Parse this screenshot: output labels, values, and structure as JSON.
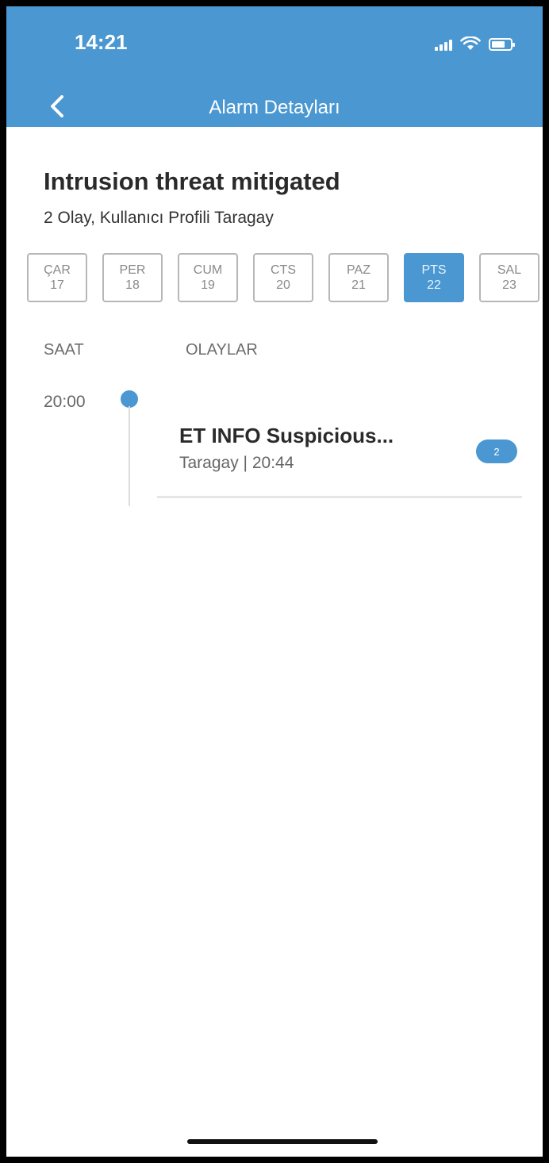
{
  "status_bar": {
    "time": "14:21"
  },
  "header": {
    "title": "Alarm Detayları"
  },
  "alarm": {
    "title": "Intrusion threat mitigated",
    "subtitle": "2 Olay, Kullanıcı Profili Taragay"
  },
  "days": [
    {
      "name": "ÇAR",
      "num": "17",
      "selected": false
    },
    {
      "name": "PER",
      "num": "18",
      "selected": false
    },
    {
      "name": "CUM",
      "num": "19",
      "selected": false
    },
    {
      "name": "CTS",
      "num": "20",
      "selected": false
    },
    {
      "name": "PAZ",
      "num": "21",
      "selected": false
    },
    {
      "name": "PTS",
      "num": "22",
      "selected": true
    },
    {
      "name": "SAL",
      "num": "23",
      "selected": false
    }
  ],
  "columns": {
    "saat": "SAAT",
    "olaylar": "OLAYLAR"
  },
  "timeline": {
    "time": "20:00",
    "event": {
      "title": "ET INFO Suspicious...",
      "subtitle": "Taragay | 20:44",
      "count": "2"
    }
  },
  "colors": {
    "accent": "#4a97d1"
  }
}
